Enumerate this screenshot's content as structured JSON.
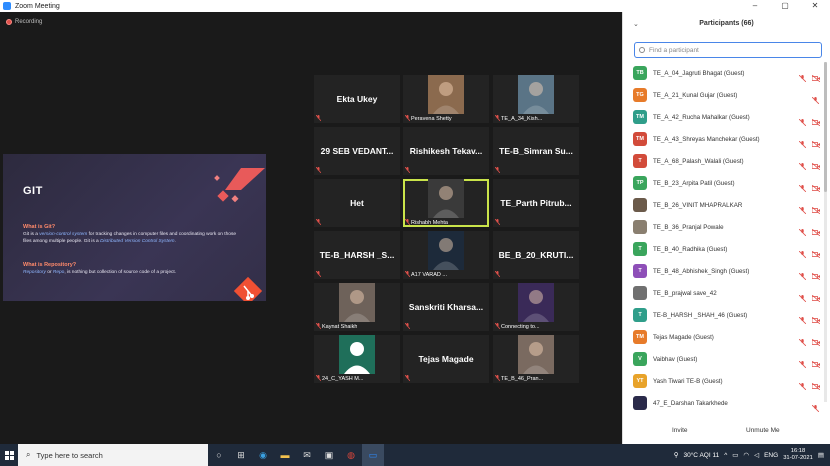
{
  "window": {
    "title": "Zoom Meeting",
    "controls": [
      "–",
      "▢",
      "✕"
    ]
  },
  "recording": {
    "label": "Recording"
  },
  "share": {
    "title": "GIT",
    "q1": "What is Git?",
    "a1_parts": [
      "Git is a ",
      "version-control system",
      " for tracking changes in computer files and coordinating work on those files among multiple people. Git is a ",
      "Distributed Version Control System",
      "."
    ],
    "q2": "What is Repository?",
    "a2_parts": [
      "Repository",
      " or ",
      "Repo",
      ", is nothing but collection of source code of a project."
    ]
  },
  "tiles": [
    {
      "name": "Ekta Ukey",
      "label": "",
      "type": "name"
    },
    {
      "name": "",
      "label": "Peravena Shetty",
      "type": "photo",
      "color": "#8b6a4e"
    },
    {
      "name": "",
      "label": "TE_A_34_Kish...",
      "type": "photo",
      "color": "#5a7486"
    },
    {
      "name": "29 SEB VEDANT...",
      "label": "",
      "type": "name"
    },
    {
      "name": "Rishikesh Tekav...",
      "label": "",
      "type": "name"
    },
    {
      "name": "TE-B_Simran Su...",
      "label": "",
      "type": "name"
    },
    {
      "name": "Het",
      "label": "",
      "type": "name"
    },
    {
      "name": "",
      "label": "Rishabh Mehta",
      "type": "photo",
      "color": "#3a3a3a",
      "active": true
    },
    {
      "name": "TE_Parth Pitrub...",
      "label": "",
      "type": "name"
    },
    {
      "name": "TE-B_HARSH _S...",
      "label": "",
      "type": "name"
    },
    {
      "name": "",
      "label": "A17 VARAD ...",
      "type": "photo",
      "color": "#1d2a3a"
    },
    {
      "name": "BE_B_20_KRUTI...",
      "label": "",
      "type": "name"
    },
    {
      "name": "",
      "label": "Kaynat Shaikh",
      "type": "photo",
      "color": "#6e625a"
    },
    {
      "name": "Sanskriti Kharsa...",
      "label": "",
      "type": "name"
    },
    {
      "name": "",
      "label": "Connecting to...",
      "type": "photo",
      "color": "#3a2a58"
    },
    {
      "name": "",
      "label": "24_C_YASH M...",
      "type": "avatar",
      "color": "#1f6f5a"
    },
    {
      "name": "Tejas Magade",
      "label": "",
      "type": "name"
    },
    {
      "name": "",
      "label": "TE_B_46_Pran...",
      "type": "photo",
      "color": "#7a6a60"
    }
  ],
  "panel": {
    "title": "Participants (66)",
    "search_placeholder": "Find a participant",
    "invite": "Invite",
    "unmute": "Unmute Me",
    "participants": [
      {
        "initials": "TB",
        "color": "#3aa55c",
        "name": "TE_A_04_Jagruti Bhagat (Guest)",
        "video": true
      },
      {
        "initials": "TG",
        "color": "#e77b2a",
        "name": "TE_A_21_Kunal Gujar (Guest)",
        "video": false
      },
      {
        "initials": "TM",
        "color": "#2f9e8a",
        "name": "TE_A_42_Rucha Mahalkar (Guest)",
        "video": true
      },
      {
        "initials": "TM",
        "color": "#d24b3a",
        "name": "TE_A_43_Shreyas Manchekar (Guest)",
        "video": true
      },
      {
        "initials": "T",
        "color": "#d24b3a",
        "name": "TE_A_68_Palash_Walali (Guest)",
        "video": true
      },
      {
        "initials": "TP",
        "color": "#3aa55c",
        "name": "TE_B_23_Arpita Patil (Guest)",
        "video": true
      },
      {
        "initials": "",
        "color": "#6b5a4a",
        "name": "TE_B_26_VINIT MHAPRALKAR",
        "video": true
      },
      {
        "initials": "",
        "color": "#8a7f70",
        "name": "TE_B_36_Pranjal Powale",
        "video": true
      },
      {
        "initials": "T",
        "color": "#3aa55c",
        "name": "TE_B_40_Radhika (Guest)",
        "video": true
      },
      {
        "initials": "T",
        "color": "#8e4fb8",
        "name": "TE_B_48_Abhishek_Singh (Guest)",
        "video": true
      },
      {
        "initials": "",
        "color": "#707070",
        "name": "TE_B_prajwal save_42",
        "video": true
      },
      {
        "initials": "T",
        "color": "#2f9e8a",
        "name": "TE-B_HARSH _SHAH_46 (Guest)",
        "video": true
      },
      {
        "initials": "TM",
        "color": "#e77b2a",
        "name": "Tejas Magade (Guest)",
        "video": true
      },
      {
        "initials": "V",
        "color": "#3aa55c",
        "name": "Vaibhav (Guest)",
        "video": true
      },
      {
        "initials": "YT",
        "color": "#e8a32a",
        "name": "Yash Tiwari TE-B (Guest)",
        "video": true
      },
      {
        "initials": "",
        "color": "#2a2a4a",
        "name": "47_E_Darshan Takarkhede",
        "video": false
      }
    ]
  },
  "taskbar": {
    "search_placeholder": "Type here to search",
    "weather": "30°C  AQI 11",
    "lang": "ENG",
    "time": "16:18",
    "date": "31-07-2021"
  }
}
